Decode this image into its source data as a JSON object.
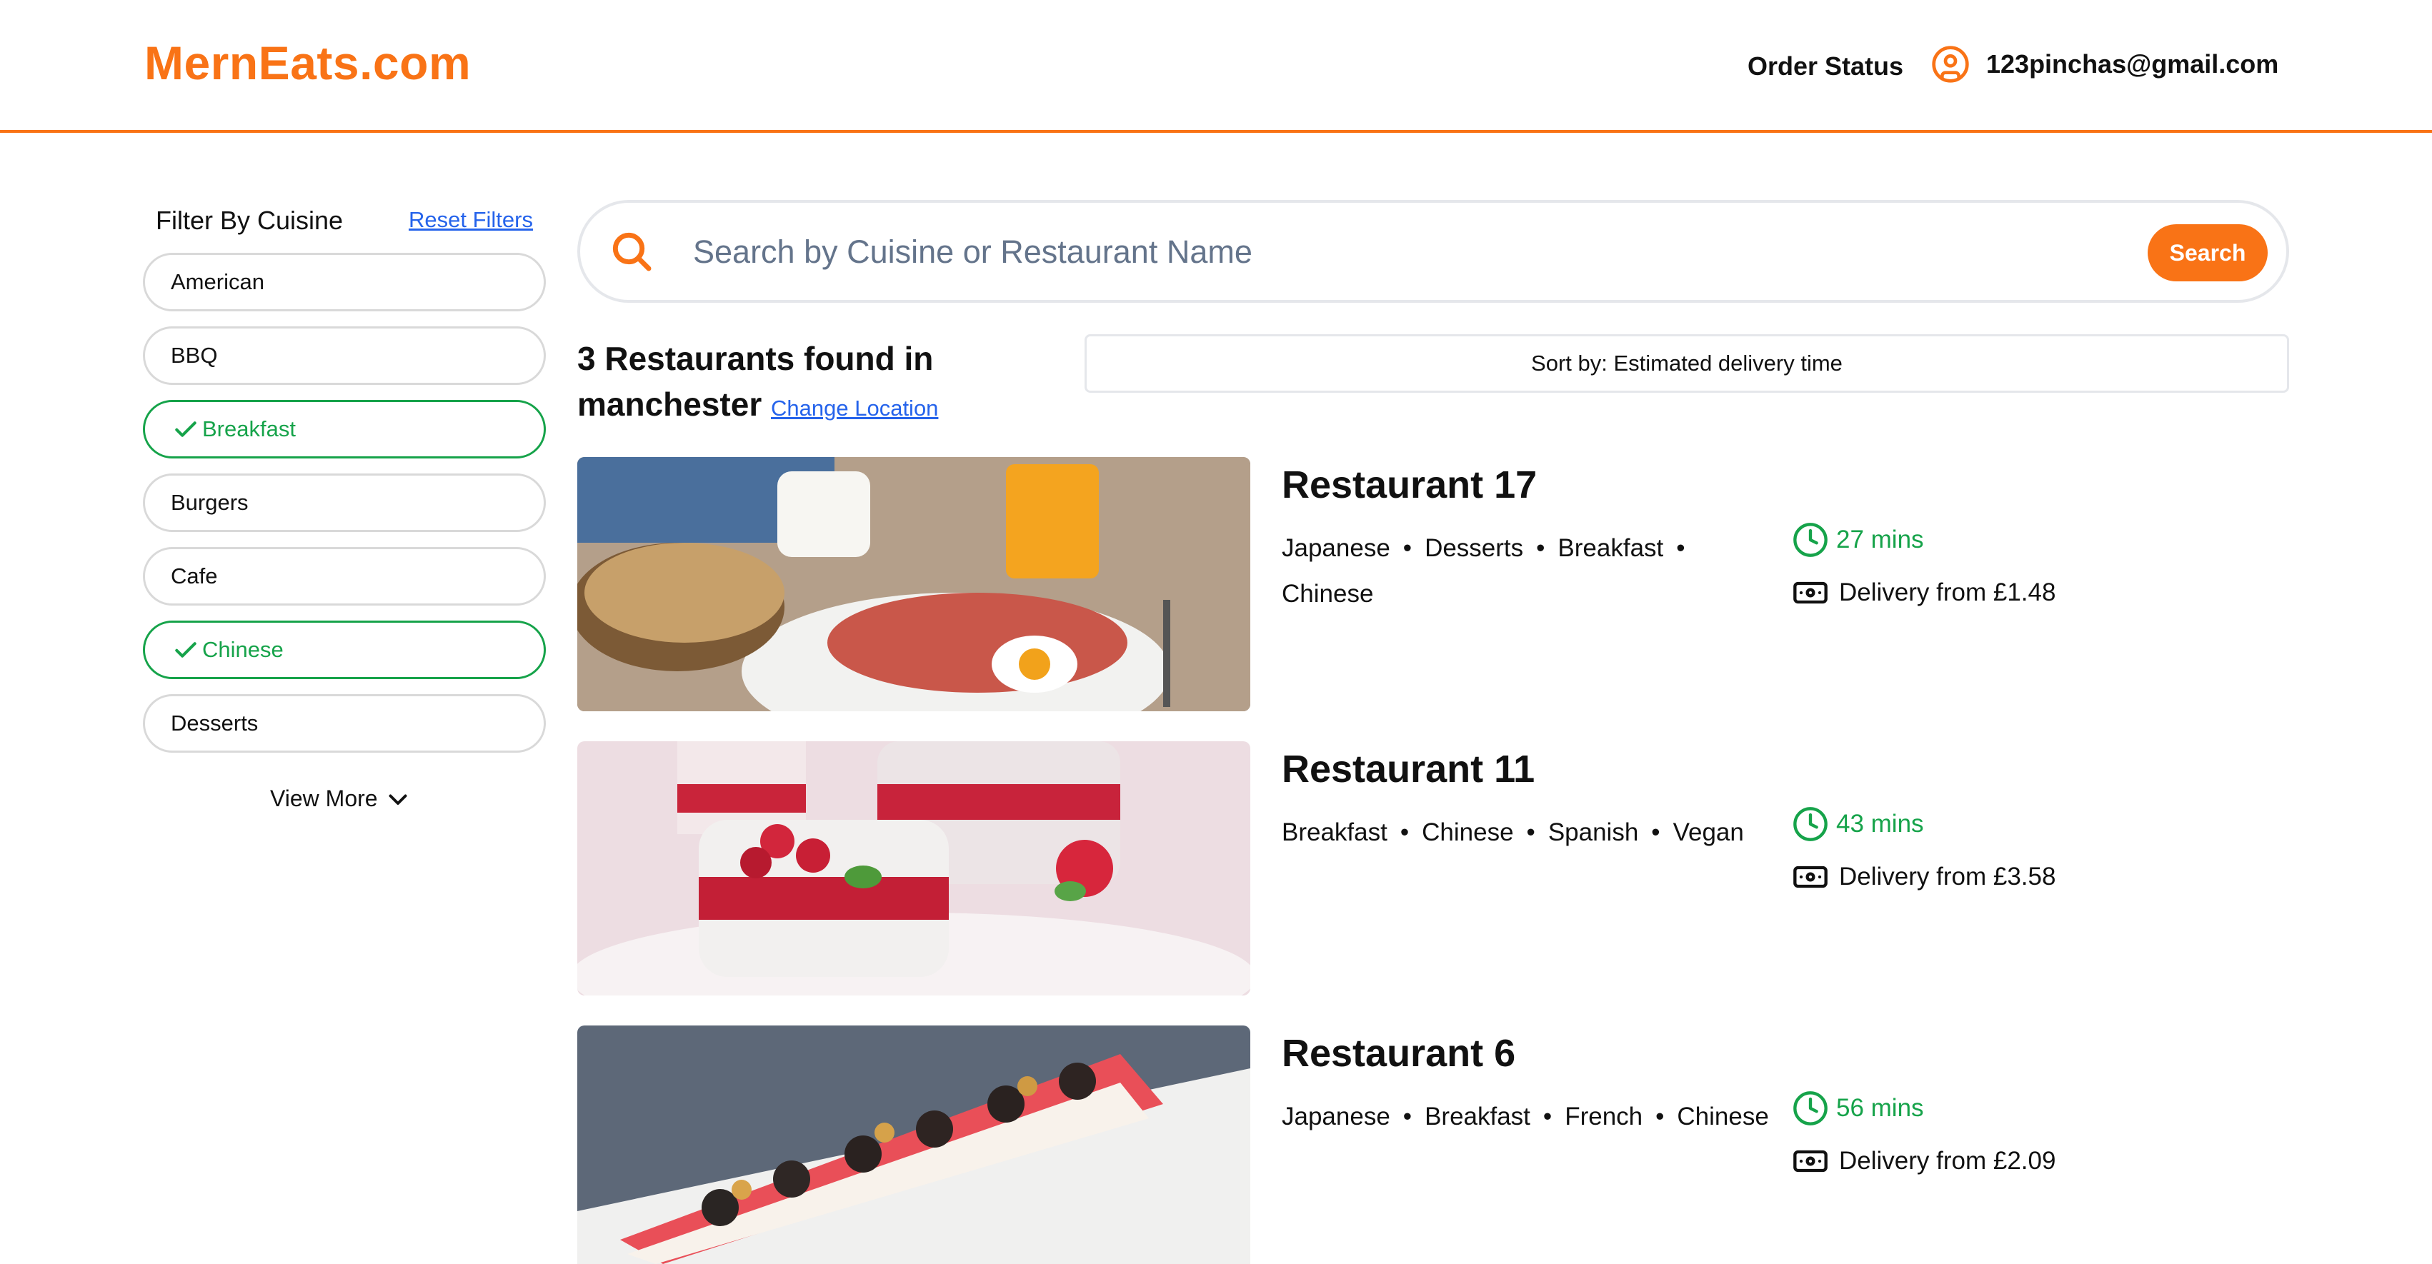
{
  "header": {
    "brand": "MernEats.com",
    "order_status": "Order Status",
    "user_email": "123pinchas@gmail.com"
  },
  "sidebar": {
    "title": "Filter By Cuisine",
    "reset": "Reset Filters",
    "cuisines": [
      {
        "label": "American",
        "checked": false
      },
      {
        "label": "BBQ",
        "checked": false
      },
      {
        "label": "Breakfast",
        "checked": true
      },
      {
        "label": "Burgers",
        "checked": false
      },
      {
        "label": "Cafe",
        "checked": false
      },
      {
        "label": "Chinese",
        "checked": true
      },
      {
        "label": "Desserts",
        "checked": false
      }
    ],
    "view_more": "View More"
  },
  "search": {
    "placeholder": "Search by Cuisine or Restaurant Name",
    "button": "Search"
  },
  "results": {
    "heading": "3 Restaurants found in manchester",
    "change_location": "Change Location"
  },
  "sort": {
    "label": "Sort by: Estimated delivery time"
  },
  "restaurants": [
    {
      "name": "Restaurant 17",
      "cuisines": [
        "Japanese",
        "Desserts",
        "Breakfast",
        "Chinese"
      ],
      "time": "27 mins",
      "delivery": "Delivery from £1.48",
      "image": "breakfast-plate"
    },
    {
      "name": "Restaurant 11",
      "cuisines": [
        "Breakfast",
        "Chinese",
        "Spanish",
        "Vegan"
      ],
      "time": "43 mins",
      "delivery": "Delivery from £3.58",
      "image": "raspberry-panna-cotta"
    },
    {
      "name": "Restaurant 6",
      "cuisines": [
        "Japanese",
        "Breakfast",
        "French",
        "Chinese"
      ],
      "time": "56 mins",
      "delivery": "Delivery from £2.09",
      "image": "sushi-roll-platter"
    }
  ],
  "colors": {
    "accent": "#f97316",
    "success": "#16a34a",
    "link": "#2563eb"
  }
}
